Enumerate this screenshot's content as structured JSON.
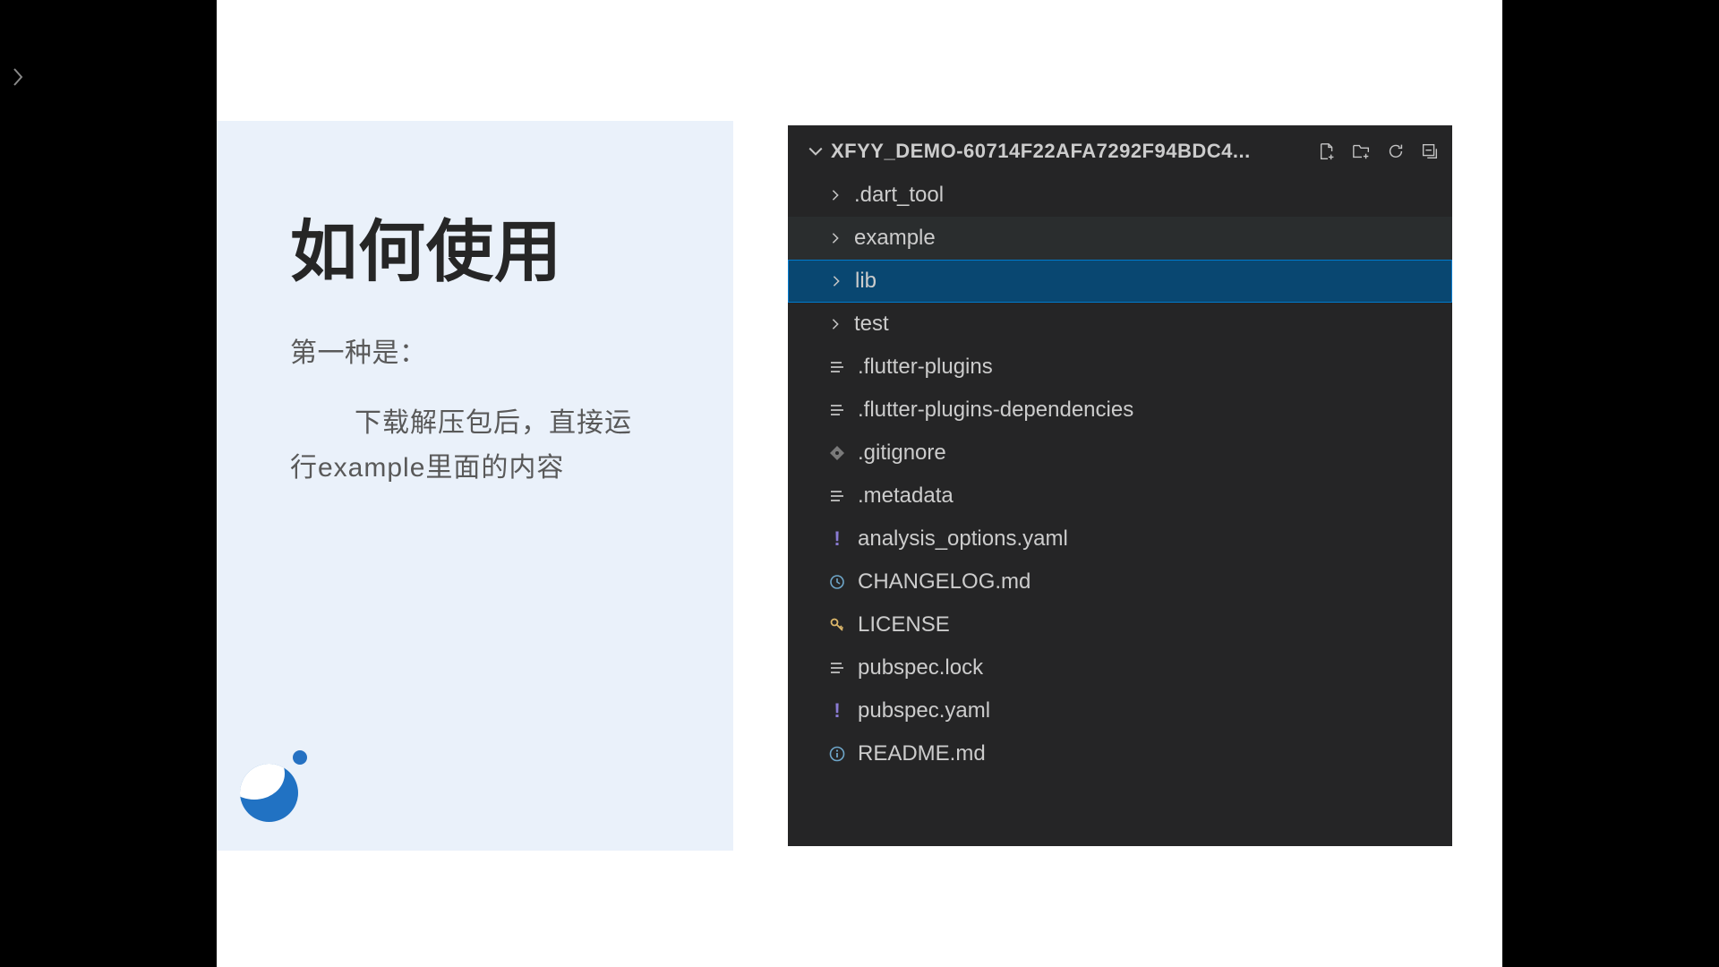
{
  "slide": {
    "title": "如何使用",
    "subtitle": "第一种是：",
    "body_line1": "下载解压包后，直接运",
    "body_line2": "行example里面的内容"
  },
  "explorer": {
    "project_name": "XFYY_DEMO-60714F22AFA7292F94BDC4...",
    "items": [
      {
        "type": "folder",
        "name": ".dart_tool",
        "expanded": false,
        "state": "normal",
        "icon": "chevron"
      },
      {
        "type": "folder",
        "name": "example",
        "expanded": false,
        "state": "hover",
        "icon": "chevron"
      },
      {
        "type": "folder",
        "name": "lib",
        "expanded": false,
        "state": "selected",
        "icon": "chevron"
      },
      {
        "type": "folder",
        "name": "test",
        "expanded": false,
        "state": "normal",
        "icon": "chevron"
      },
      {
        "type": "file",
        "name": ".flutter-plugins",
        "state": "normal",
        "icon": "lines"
      },
      {
        "type": "file",
        "name": ".flutter-plugins-dependencies",
        "state": "normal",
        "icon": "lines"
      },
      {
        "type": "file",
        "name": ".gitignore",
        "state": "normal",
        "icon": "gitignore"
      },
      {
        "type": "file",
        "name": ".metadata",
        "state": "normal",
        "icon": "lines"
      },
      {
        "type": "file",
        "name": "analysis_options.yaml",
        "state": "normal",
        "icon": "exclaim"
      },
      {
        "type": "file",
        "name": "CHANGELOG.md",
        "state": "normal",
        "icon": "clock"
      },
      {
        "type": "file",
        "name": "LICENSE",
        "state": "normal",
        "icon": "key"
      },
      {
        "type": "file",
        "name": "pubspec.lock",
        "state": "normal",
        "icon": "lines"
      },
      {
        "type": "file",
        "name": "pubspec.yaml",
        "state": "normal",
        "icon": "exclaim"
      },
      {
        "type": "file",
        "name": "README.md",
        "state": "normal",
        "icon": "info"
      }
    ]
  }
}
